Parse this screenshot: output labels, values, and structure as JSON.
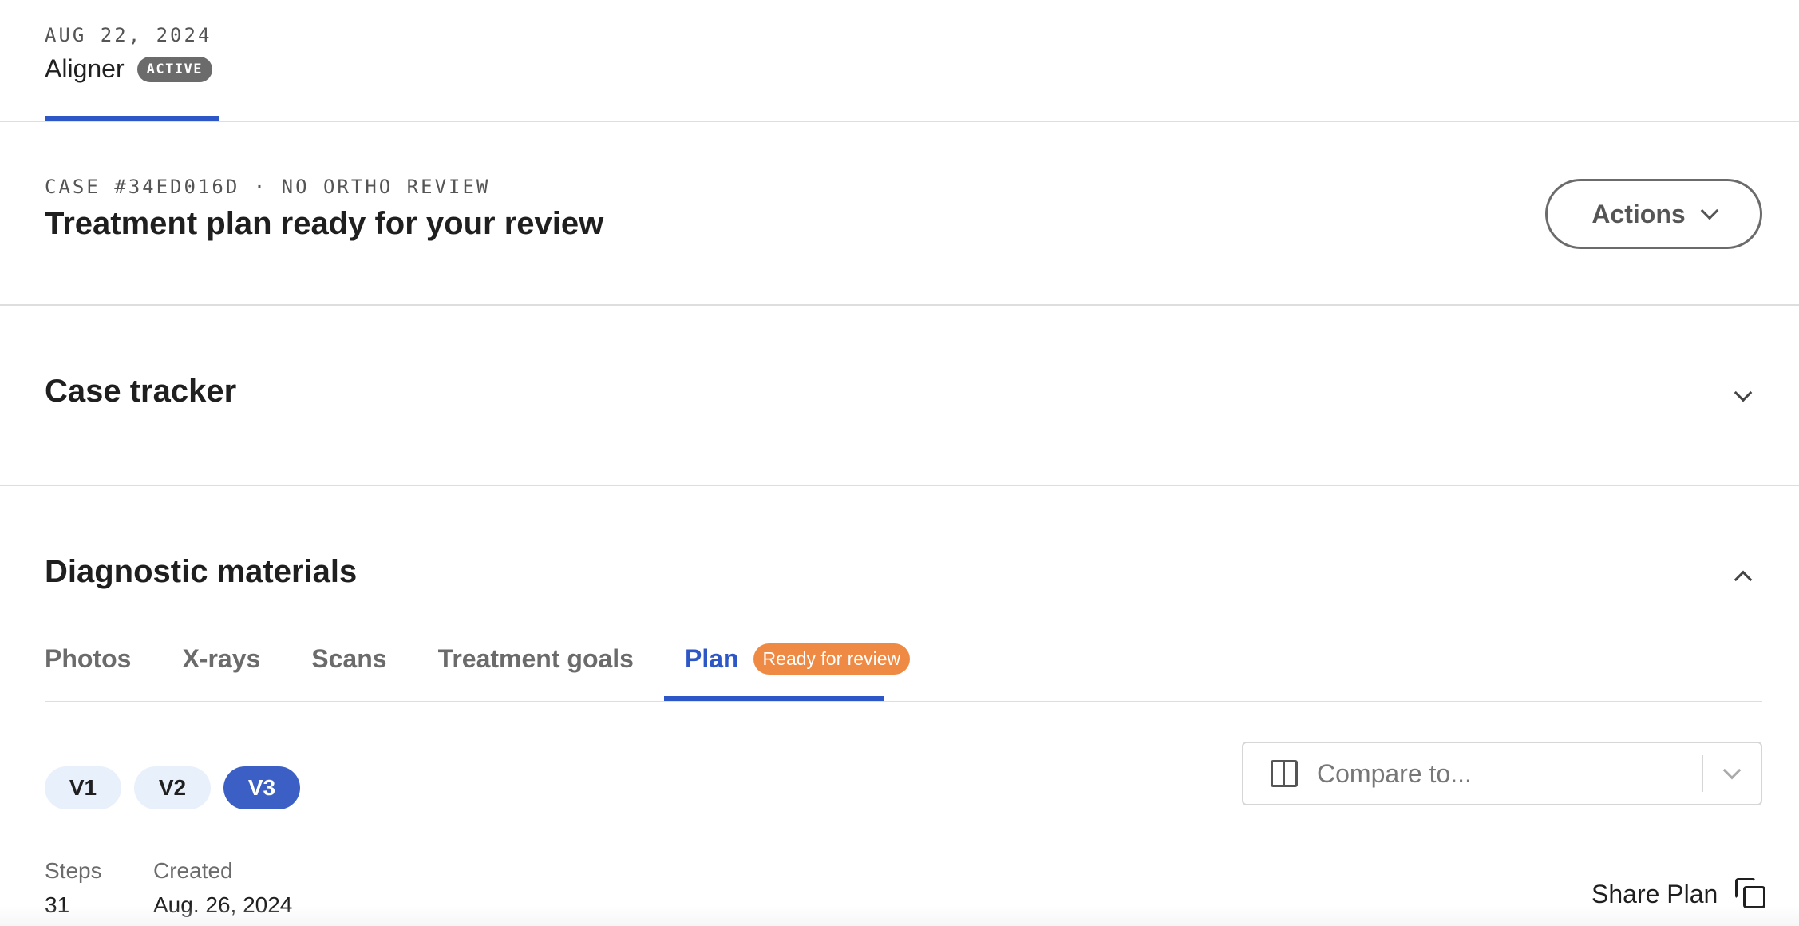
{
  "header": {
    "date": "AUG 22, 2024",
    "title": "Aligner",
    "status_badge": "ACTIVE"
  },
  "case": {
    "label": "CASE #34ED016D · NO ORTHO REVIEW",
    "title": "Treatment plan ready for your review",
    "actions_label": "Actions"
  },
  "sections": {
    "case_tracker": "Case tracker",
    "diagnostic_materials": "Diagnostic materials"
  },
  "tabs": [
    {
      "label": "Photos"
    },
    {
      "label": "X-rays"
    },
    {
      "label": "Scans"
    },
    {
      "label": "Treatment goals"
    },
    {
      "label": "Plan",
      "badge": "Ready for review",
      "active": true
    }
  ],
  "colors": {
    "accent": "#2d56c6",
    "badge_orange": "#ef8a44",
    "badge_gray": "#6b6b6b"
  },
  "versions": [
    "V1",
    "V2",
    "V3"
  ],
  "selected_version": "V3",
  "compare": {
    "placeholder": "Compare to...",
    "icon": "split-view-icon"
  },
  "meta": {
    "steps_label": "Steps",
    "steps_value": "31",
    "created_label": "Created",
    "created_value": "Aug. 26, 2024"
  },
  "share_label": "Share Plan"
}
